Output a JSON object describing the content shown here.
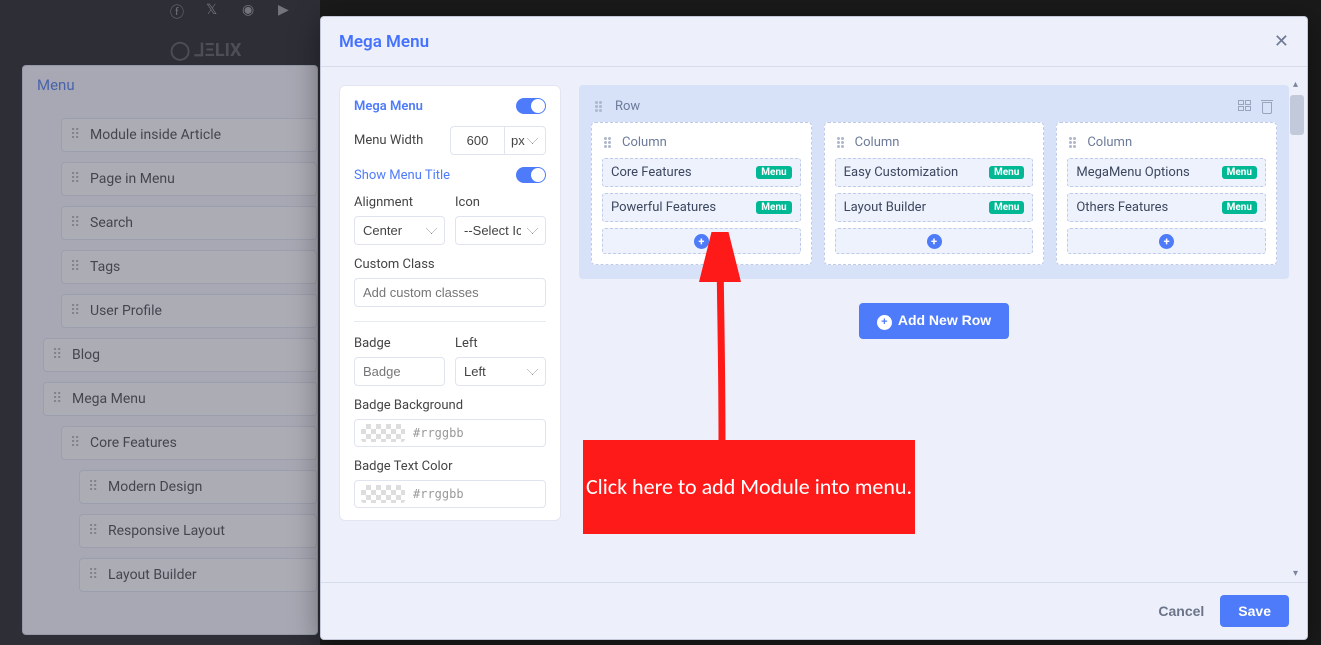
{
  "left_menu": {
    "title": "Menu",
    "items": [
      "Module inside Article",
      "Page in Menu",
      "Search",
      "Tags",
      "User Profile",
      "Blog",
      "Mega Menu",
      "Core Features",
      "Modern Design",
      "Responsive Layout",
      "Layout Builder"
    ]
  },
  "modal": {
    "title": "Mega Menu",
    "cancel": "Cancel",
    "save": "Save"
  },
  "form": {
    "mega_menu_label": "Mega Menu",
    "menu_width_label": "Menu Width",
    "menu_width_value": "600",
    "menu_width_unit": "px",
    "show_title_label": "Show Menu Title",
    "alignment_label": "Alignment",
    "alignment_value": "Center",
    "icon_label": "Icon",
    "icon_value": "--Select Icon--",
    "custom_class_label": "Custom Class",
    "custom_class_placeholder": "Add custom classes",
    "badge_label": "Badge",
    "badge_placeholder": "Badge",
    "badge_pos_label": "Left",
    "badge_pos_value": "Left",
    "badge_bg_label": "Badge Background",
    "badge_text_label": "Badge Text Color",
    "color_placeholder": "#rrggbb"
  },
  "builder": {
    "row_label": "Row",
    "column_label": "Column",
    "menu_badge": "Menu",
    "add_row": "Add New Row",
    "columns": [
      {
        "items": [
          "Core Features",
          "Powerful Features"
        ]
      },
      {
        "items": [
          "Easy Customization",
          "Layout Builder"
        ]
      },
      {
        "items": [
          "MegaMenu Options",
          "Others Features"
        ]
      }
    ]
  },
  "callout": "Click here to add Module into menu."
}
